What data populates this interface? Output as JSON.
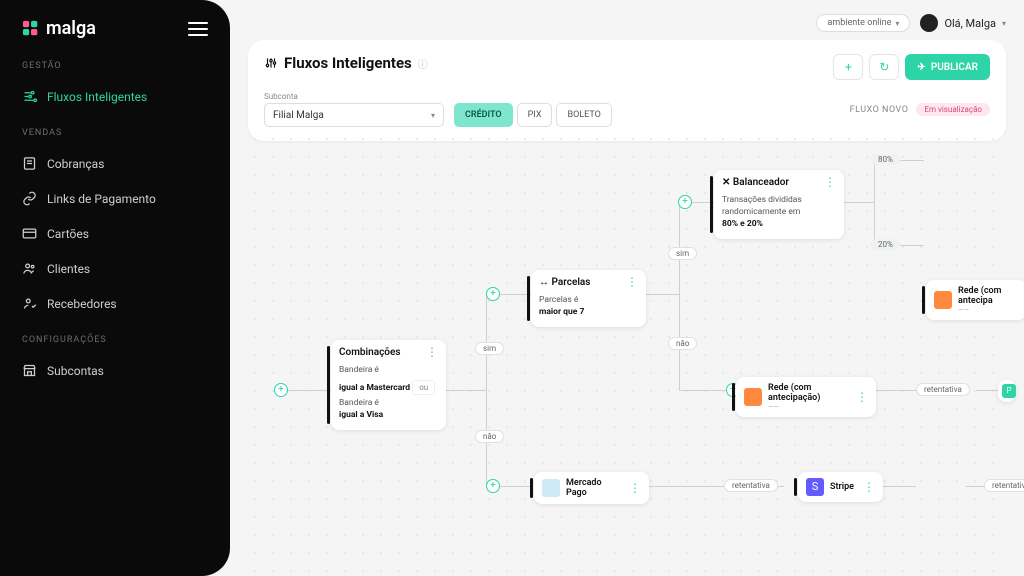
{
  "logo": "malga",
  "sections": {
    "gestao": "GESTÃO",
    "vendas": "VENDAS",
    "config": "CONFIGURAÇÕES"
  },
  "nav": {
    "fluxos": "Fluxos Inteligentes",
    "cobrancas": "Cobranças",
    "links": "Links de Pagamento",
    "cartoes": "Cartões",
    "clientes": "Clientes",
    "recebedores": "Recebedores",
    "subcontas": "Subcontas"
  },
  "top": {
    "env": "ambiente online",
    "greeting": "Olá, Malga"
  },
  "page": {
    "title": "Fluxos Inteligentes",
    "publish": "PUBLICAR",
    "subcontaLabel": "Subconta",
    "subcontaValue": "Filial Malga",
    "tabs": {
      "credito": "CRÉDITO",
      "pix": "PIX",
      "boleto": "BOLETO"
    },
    "flowLabel": "FLUXO NOVO",
    "vis": "Em visualização"
  },
  "nodes": {
    "comb": {
      "title": "Combinações",
      "l1a": "Bandeira é",
      "l1b": "igual a Mastercard",
      "or": "ou",
      "l2a": "Bandeira é",
      "l2b": "igual a Visa"
    },
    "parcelas": {
      "title": "Parcelas",
      "l1": "Parcelas é",
      "l2": "maior que 7"
    },
    "bal": {
      "title": "Balanceador",
      "l1": "Transações divididas",
      "l2": "randomicamente em",
      "l3": "80% e 20%"
    },
    "pct80": "80%",
    "pct20": "20%",
    "sim": "sim",
    "nao": "não",
    "retentativa": "retentativa",
    "prov": {
      "mp": "Mercado Pago",
      "rede": "Rede (com antecipação)",
      "rede2": "Rede (com antecipa",
      "stripe": "Stripe"
    }
  }
}
